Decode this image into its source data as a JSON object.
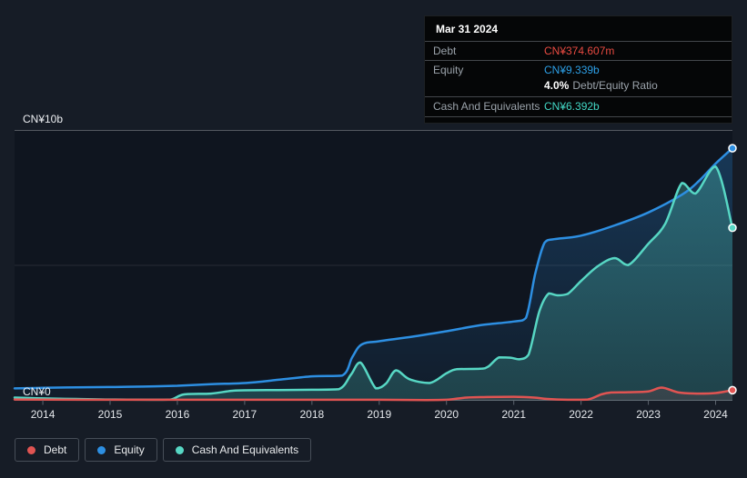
{
  "colors": {
    "page_bg": "#161c26",
    "plot_bg": "#0f151f",
    "debt": "#e05452",
    "equity": "#2d8fe2",
    "cash": "#57d7c4",
    "grid_top": "rgba(255,255,255,0.28)",
    "grid_mid": "rgba(255,255,255,0.10)",
    "axis_line": "#5c636d"
  },
  "tooltip": {
    "date": "Mar 31 2024",
    "debt_label": "Debt",
    "debt_value": "CN¥374.607m",
    "equity_label": "Equity",
    "equity_value": "CN¥9.339b",
    "ratio_value": "4.0%",
    "ratio_label": "Debt/Equity Ratio",
    "cash_label": "Cash And Equivalents",
    "cash_value": "CN¥6.392b"
  },
  "axis": {
    "y_top_label": "CN¥10b",
    "y_zero_label": "CN¥0",
    "years": [
      "2014",
      "2015",
      "2016",
      "2017",
      "2018",
      "2019",
      "2020",
      "2021",
      "2022",
      "2023",
      "2024"
    ]
  },
  "legend": {
    "items": [
      {
        "label": "Debt",
        "color": "#e05452"
      },
      {
        "label": "Equity",
        "color": "#2d8fe2"
      },
      {
        "label": "Cash And Equivalents",
        "color": "#57d7c4"
      }
    ]
  },
  "chart_data": {
    "type": "area",
    "unit": "CN¥ billions",
    "x_range": [
      2013.58,
      2024.25
    ],
    "y_range": [
      0,
      10
    ],
    "grid_y_values": [
      0,
      5,
      10
    ],
    "legend_position": "bottom-left",
    "latest": {
      "date": "Mar 31 2024",
      "debt_b": 0.374607,
      "equity_b": 9.339,
      "cash_b": 6.392,
      "debt_equity_ratio_pct": 4.0
    },
    "series": [
      {
        "name": "Equity",
        "color": "#2d8fe2",
        "fill_top_opacity": 0.3,
        "fill_bottom_opacity": 0.06,
        "points": [
          [
            2013.58,
            0.44
          ],
          [
            2014,
            0.46
          ],
          [
            2014.5,
            0.48
          ],
          [
            2015,
            0.49
          ],
          [
            2015.5,
            0.51
          ],
          [
            2016,
            0.54
          ],
          [
            2016.5,
            0.6
          ],
          [
            2017,
            0.64
          ],
          [
            2017.5,
            0.76
          ],
          [
            2018,
            0.89
          ],
          [
            2018.45,
            0.92
          ],
          [
            2018.6,
            1.6
          ],
          [
            2018.74,
            2.07
          ],
          [
            2019,
            2.19
          ],
          [
            2019.5,
            2.36
          ],
          [
            2020,
            2.56
          ],
          [
            2020.5,
            2.78
          ],
          [
            2021,
            2.92
          ],
          [
            2021.18,
            3.05
          ],
          [
            2021.32,
            4.7
          ],
          [
            2021.46,
            5.85
          ],
          [
            2021.6,
            5.97
          ],
          [
            2022,
            6.1
          ],
          [
            2022.5,
            6.48
          ],
          [
            2023,
            6.96
          ],
          [
            2023.5,
            7.62
          ],
          [
            2023.75,
            8.12
          ],
          [
            2024,
            8.77
          ],
          [
            2024.25,
            9.339
          ]
        ]
      },
      {
        "name": "Cash And Equivalents",
        "color": "#57d7c4",
        "fill_top_opacity": 0.32,
        "fill_bottom_opacity": 0.2,
        "points": [
          [
            2013.58,
            0.1
          ],
          [
            2014,
            0.07
          ],
          [
            2014.5,
            0.05
          ],
          [
            2015,
            0.03
          ],
          [
            2015.6,
            0.02
          ],
          [
            2015.9,
            0.03
          ],
          [
            2016.1,
            0.22
          ],
          [
            2016.5,
            0.25
          ],
          [
            2016.8,
            0.35
          ],
          [
            2017,
            0.37
          ],
          [
            2017.5,
            0.38
          ],
          [
            2018,
            0.39
          ],
          [
            2018.4,
            0.41
          ],
          [
            2018.58,
            0.95
          ],
          [
            2018.72,
            1.4
          ],
          [
            2018.95,
            0.44
          ],
          [
            2019.1,
            0.62
          ],
          [
            2019.25,
            1.11
          ],
          [
            2019.45,
            0.78
          ],
          [
            2019.75,
            0.64
          ],
          [
            2020,
            1.0
          ],
          [
            2020.15,
            1.15
          ],
          [
            2020.5,
            1.17
          ],
          [
            2020.62,
            1.25
          ],
          [
            2020.78,
            1.59
          ],
          [
            2020.95,
            1.58
          ],
          [
            2021.08,
            1.52
          ],
          [
            2021.22,
            1.69
          ],
          [
            2021.38,
            3.3
          ],
          [
            2021.52,
            3.96
          ],
          [
            2021.65,
            3.89
          ],
          [
            2021.8,
            3.94
          ],
          [
            2022,
            4.42
          ],
          [
            2022.25,
            4.97
          ],
          [
            2022.5,
            5.27
          ],
          [
            2022.7,
            5.01
          ],
          [
            2023,
            5.8
          ],
          [
            2023.25,
            6.54
          ],
          [
            2023.5,
            8.05
          ],
          [
            2023.7,
            7.66
          ],
          [
            2024,
            8.66
          ],
          [
            2024.25,
            6.392
          ]
        ]
      },
      {
        "name": "Debt",
        "color": "#e05452",
        "fill_top_opacity": 0.18,
        "fill_bottom_opacity": 0.12,
        "points": [
          [
            2013.58,
            0.03
          ],
          [
            2014,
            0.025
          ],
          [
            2015,
            0.02
          ],
          [
            2016,
            0.02
          ],
          [
            2017,
            0.02
          ],
          [
            2018,
            0.02
          ],
          [
            2019,
            0.02
          ],
          [
            2019.7,
            0.01
          ],
          [
            2020,
            0.02
          ],
          [
            2020.3,
            0.1
          ],
          [
            2020.6,
            0.12
          ],
          [
            2021,
            0.13
          ],
          [
            2021.3,
            0.1
          ],
          [
            2021.5,
            0.05
          ],
          [
            2021.8,
            0.02
          ],
          [
            2022.1,
            0.03
          ],
          [
            2022.3,
            0.22
          ],
          [
            2022.45,
            0.29
          ],
          [
            2022.7,
            0.3
          ],
          [
            2023,
            0.33
          ],
          [
            2023.2,
            0.47
          ],
          [
            2023.45,
            0.29
          ],
          [
            2023.75,
            0.25
          ],
          [
            2024,
            0.27
          ],
          [
            2024.25,
            0.375
          ]
        ]
      }
    ]
  }
}
